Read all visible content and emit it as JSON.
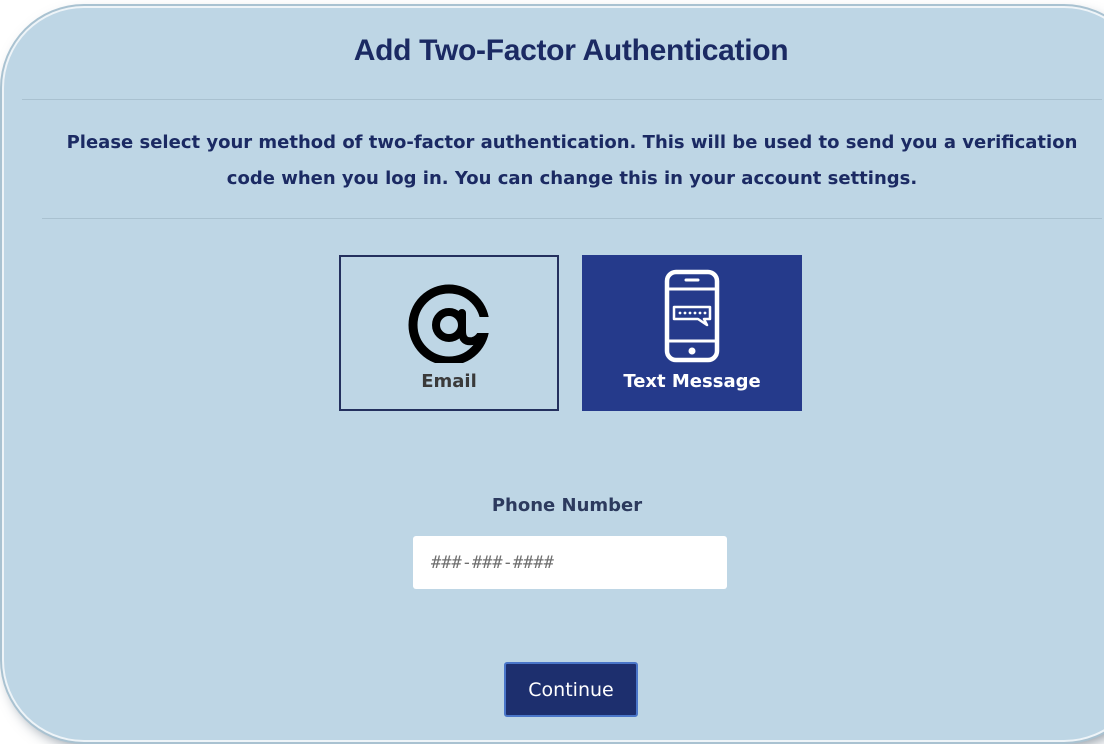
{
  "dialog": {
    "title": "Add Two-Factor Authentication",
    "description": "Please select your method of two-factor authentication. This will be used to send you a verification code when you log in. You can change this in your account settings."
  },
  "methods": [
    {
      "id": "email",
      "label": "Email",
      "icon": "at-sign-icon",
      "selected": false
    },
    {
      "id": "text",
      "label": "Text Message",
      "icon": "smartphone-message-icon",
      "selected": true
    }
  ],
  "phone": {
    "label": "Phone Number",
    "placeholder": "###-###-####",
    "value": ""
  },
  "actions": {
    "continue_label": "Continue"
  },
  "colors": {
    "panel_background": "#bed6e5",
    "heading_text": "#1b2a63",
    "selected_option": "#253a8b",
    "button_background": "#1d2f6e",
    "button_border": "#4a76c9"
  }
}
